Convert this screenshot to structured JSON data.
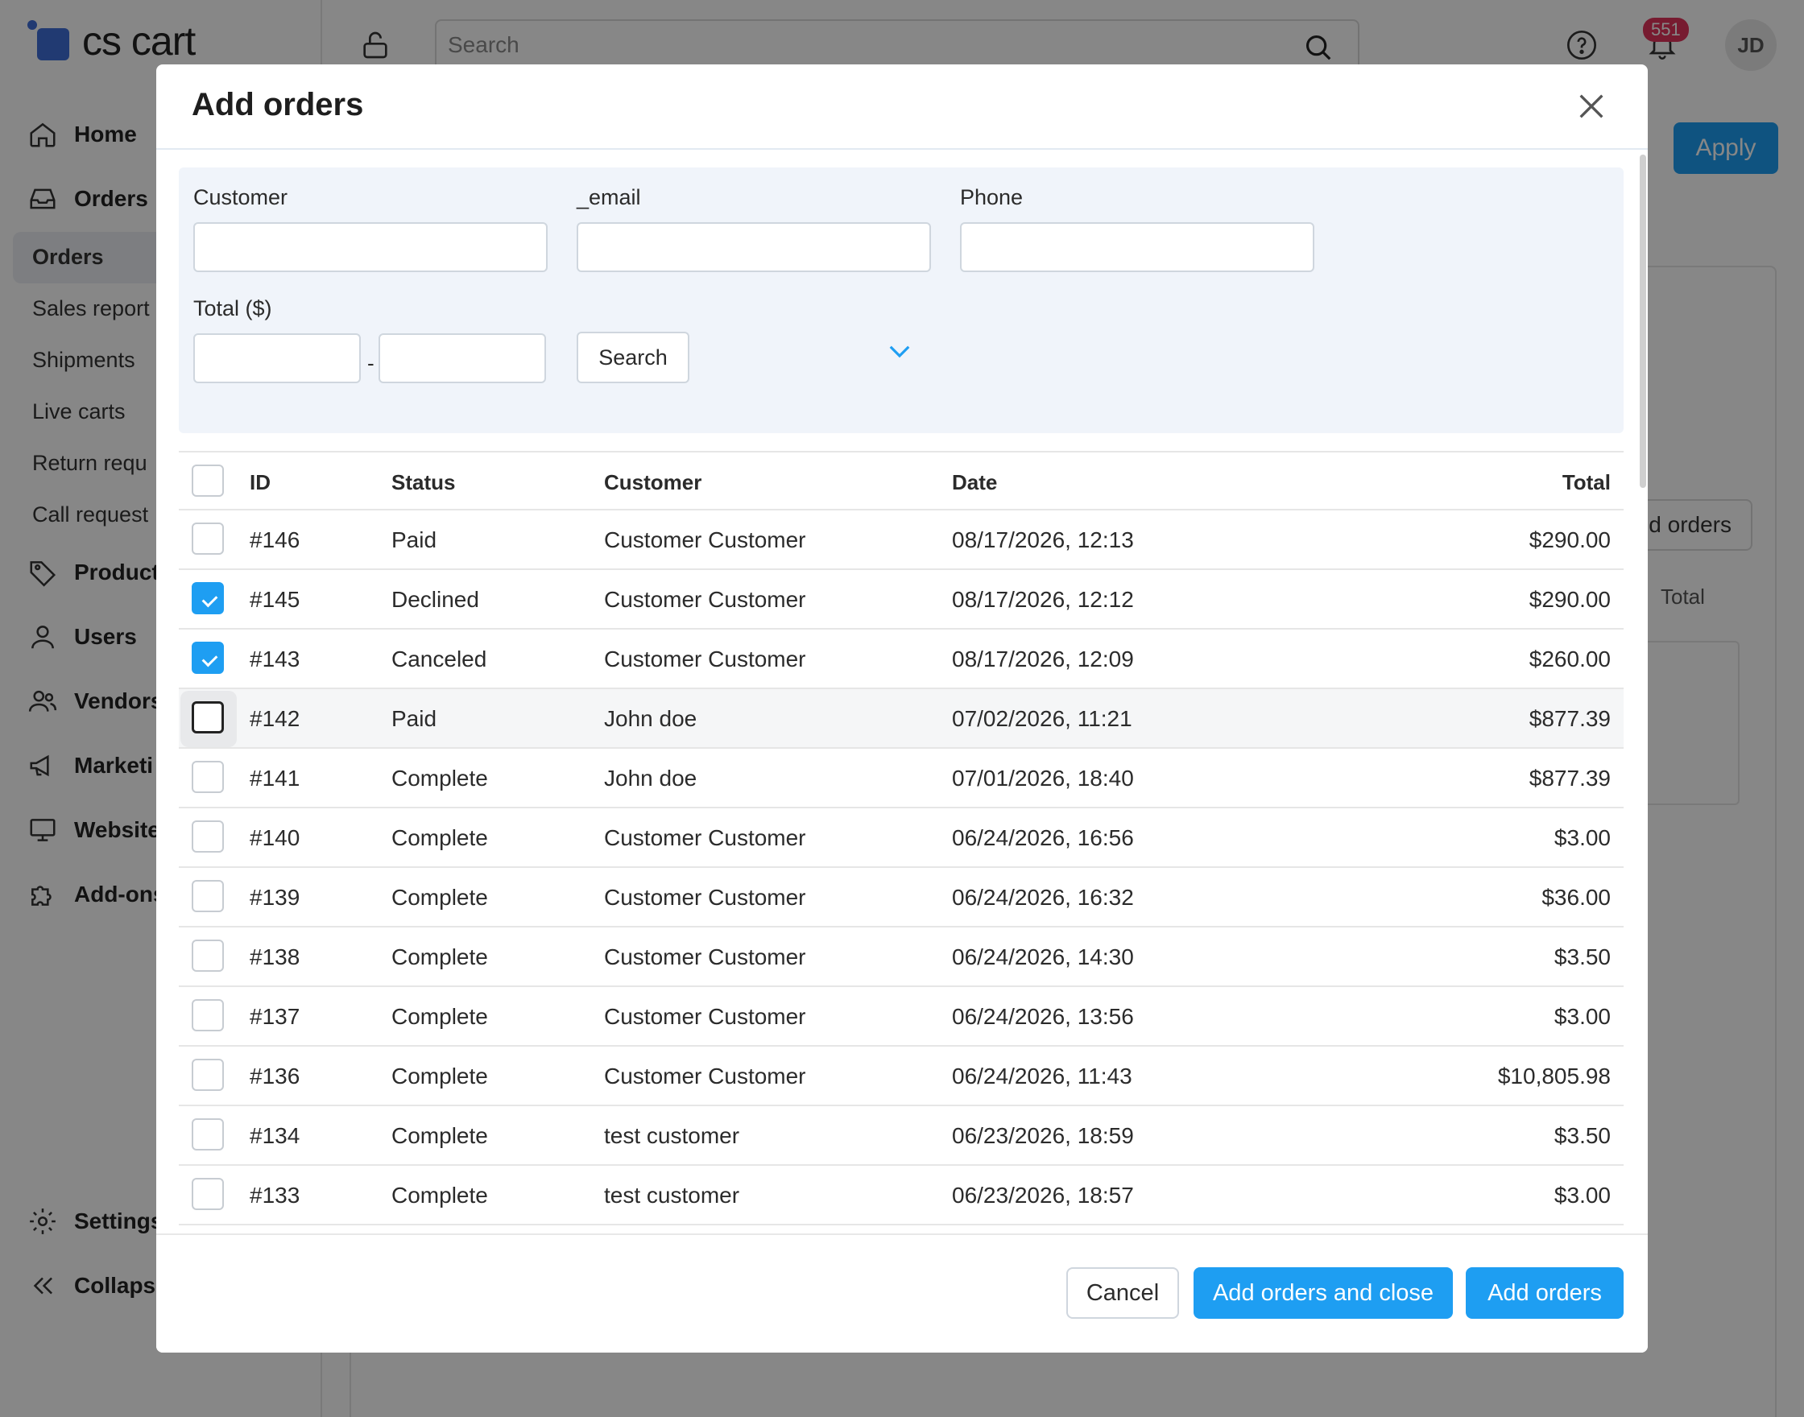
{
  "app": {
    "logo_text": "cs cart"
  },
  "sidebar": {
    "items": [
      {
        "label": "Home",
        "icon": "home-icon"
      },
      {
        "label": "Orders",
        "icon": "inbox-icon"
      },
      {
        "label": "Product",
        "icon": "tag-icon"
      },
      {
        "label": "Users",
        "icon": "user-icon"
      },
      {
        "label": "Vendors",
        "icon": "users-icon"
      },
      {
        "label": "Marketi",
        "icon": "megaphone-icon"
      },
      {
        "label": "Website",
        "icon": "monitor-icon"
      },
      {
        "label": "Add-ons",
        "icon": "puzzle-icon"
      },
      {
        "label": "Settings",
        "icon": "gear-icon"
      },
      {
        "label": "Collapse",
        "icon": "chevrons-left-icon"
      }
    ],
    "orders_sub": [
      "Orders",
      "Sales report",
      "Shipments",
      "Live carts",
      "Return requ",
      "Call request"
    ]
  },
  "topbar": {
    "search_placeholder": "Search",
    "notifications_count": "551",
    "avatar_initials": "JD"
  },
  "background_page": {
    "apply_label": "Apply",
    "add_orders_label": "Add orders",
    "total_label": "Total"
  },
  "modal": {
    "title": "Add orders",
    "filters": {
      "customer_label": "Customer",
      "email_label": "_email",
      "phone_label": "Phone",
      "total_label": "Total ($)",
      "range_separator": "-",
      "search_button": "Search",
      "customer_value": "",
      "email_value": "",
      "phone_value": "",
      "total_from": "",
      "total_to": ""
    },
    "table": {
      "headers": {
        "id": "ID",
        "status": "Status",
        "customer": "Customer",
        "date": "Date",
        "total": "Total"
      },
      "rows": [
        {
          "id": "#146",
          "status": "Paid",
          "customer": "Customer Customer",
          "date": "08/17/2026, 12:13",
          "total": "$290.00",
          "checked": false
        },
        {
          "id": "#145",
          "status": "Declined",
          "customer": "Customer Customer",
          "date": "08/17/2026, 12:12",
          "total": "$290.00",
          "checked": true
        },
        {
          "id": "#143",
          "status": "Canceled",
          "customer": "Customer Customer",
          "date": "08/17/2026, 12:09",
          "total": "$260.00",
          "checked": true
        },
        {
          "id": "#142",
          "status": "Paid",
          "customer": "John doe",
          "date": "07/02/2026, 11:21",
          "total": "$877.39",
          "checked": false
        },
        {
          "id": "#141",
          "status": "Complete",
          "customer": "John doe",
          "date": "07/01/2026, 18:40",
          "total": "$877.39",
          "checked": false
        },
        {
          "id": "#140",
          "status": "Complete",
          "customer": "Customer Customer",
          "date": "06/24/2026, 16:56",
          "total": "$3.00",
          "checked": false
        },
        {
          "id": "#139",
          "status": "Complete",
          "customer": "Customer Customer",
          "date": "06/24/2026, 16:32",
          "total": "$36.00",
          "checked": false
        },
        {
          "id": "#138",
          "status": "Complete",
          "customer": "Customer Customer",
          "date": "06/24/2026, 14:30",
          "total": "$3.50",
          "checked": false
        },
        {
          "id": "#137",
          "status": "Complete",
          "customer": "Customer Customer",
          "date": "06/24/2026, 13:56",
          "total": "$3.00",
          "checked": false
        },
        {
          "id": "#136",
          "status": "Complete",
          "customer": "Customer Customer",
          "date": "06/24/2026, 11:43",
          "total": "$10,805.98",
          "checked": false
        },
        {
          "id": "#134",
          "status": "Complete",
          "customer": "test customer",
          "date": "06/23/2026, 18:59",
          "total": "$3.50",
          "checked": false
        },
        {
          "id": "#133",
          "status": "Complete",
          "customer": "test customer",
          "date": "06/23/2026, 18:57",
          "total": "$3.00",
          "checked": false
        }
      ]
    },
    "footer": {
      "cancel": "Cancel",
      "add_and_close": "Add orders and close",
      "add": "Add orders"
    }
  },
  "colors": {
    "accent": "#1e9ef2",
    "filter_bg": "#f0f4fa",
    "badge": "#e0345b"
  }
}
